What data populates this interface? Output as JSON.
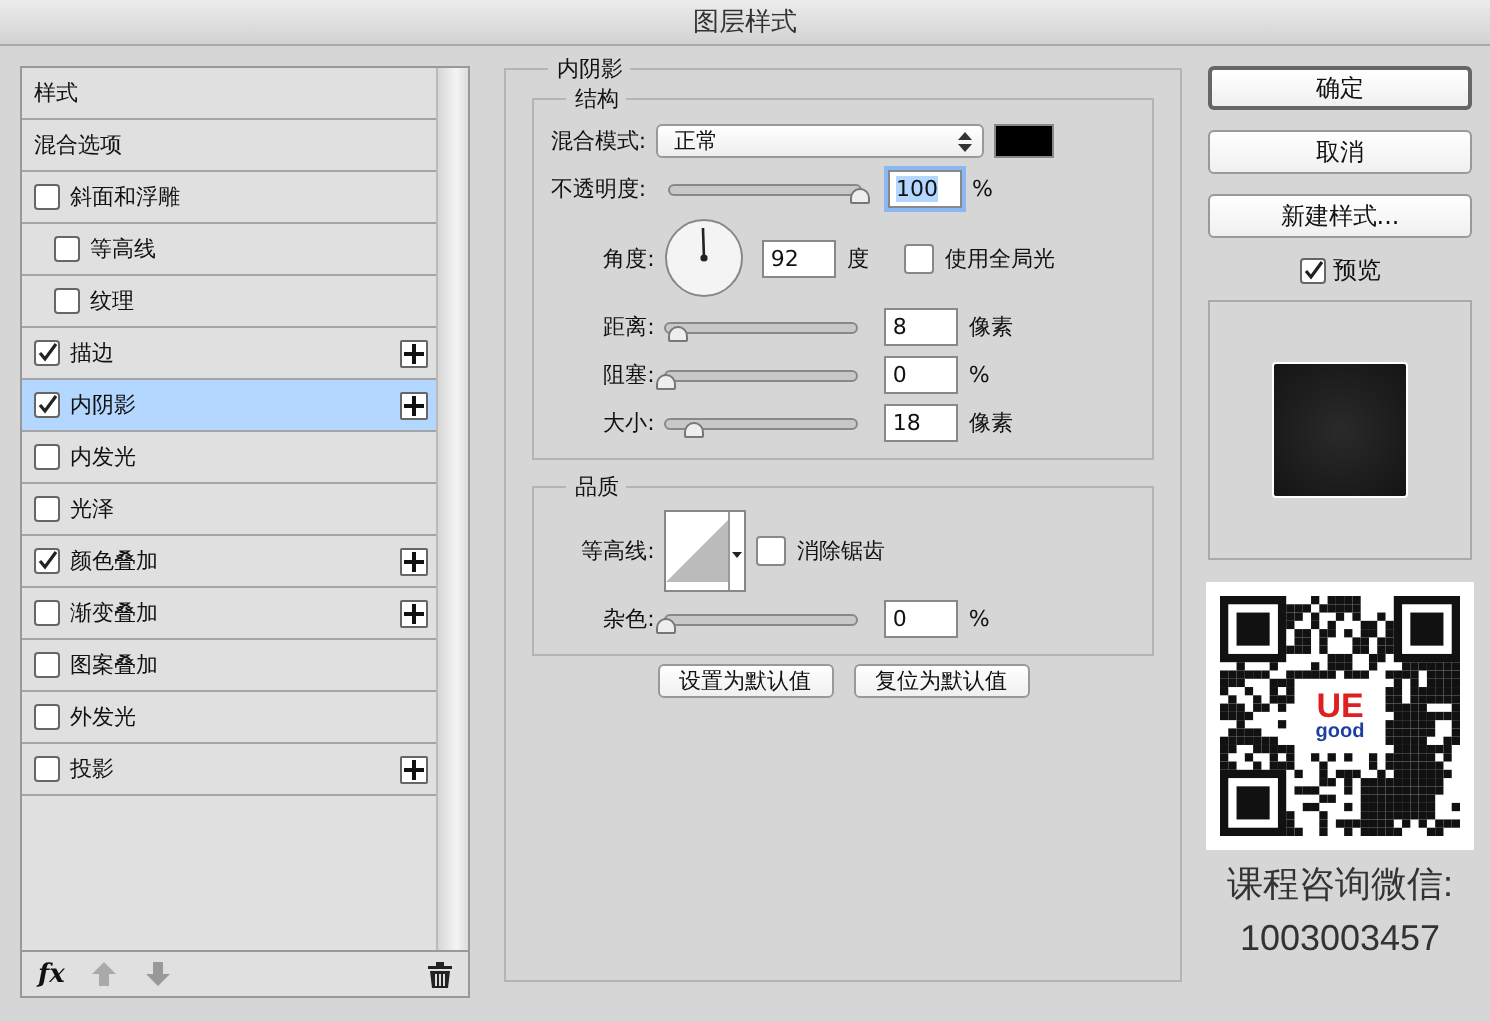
{
  "window": {
    "title": "图层样式"
  },
  "styles": {
    "items": [
      {
        "label": "样式",
        "kind": "header",
        "selected": false
      },
      {
        "label": "混合选项",
        "kind": "header",
        "selected": false
      },
      {
        "label": "斜面和浮雕",
        "kind": "check",
        "checked": false,
        "selected": false,
        "addable": false,
        "children": [
          {
            "label": "等高线",
            "kind": "check",
            "checked": false,
            "selected": false,
            "addable": false
          },
          {
            "label": "纹理",
            "kind": "check",
            "checked": false,
            "selected": false,
            "addable": false
          }
        ]
      },
      {
        "label": "描边",
        "kind": "check",
        "checked": true,
        "selected": false,
        "addable": true
      },
      {
        "label": "内阴影",
        "kind": "check",
        "checked": true,
        "selected": true,
        "addable": true
      },
      {
        "label": "内发光",
        "kind": "check",
        "checked": false,
        "selected": false,
        "addable": false
      },
      {
        "label": "光泽",
        "kind": "check",
        "checked": false,
        "selected": false,
        "addable": false
      },
      {
        "label": "颜色叠加",
        "kind": "check",
        "checked": true,
        "selected": false,
        "addable": true
      },
      {
        "label": "渐变叠加",
        "kind": "check",
        "checked": false,
        "selected": false,
        "addable": true
      },
      {
        "label": "图案叠加",
        "kind": "check",
        "checked": false,
        "selected": false,
        "addable": false
      },
      {
        "label": "外发光",
        "kind": "check",
        "checked": false,
        "selected": false,
        "addable": false
      },
      {
        "label": "投影",
        "kind": "check",
        "checked": false,
        "selected": false,
        "addable": true
      }
    ],
    "fx_label": "fx"
  },
  "effect": {
    "title": "内阴影",
    "structure": {
      "title": "结构",
      "blend_mode": {
        "label": "混合模式:",
        "value": "正常",
        "color": "#000000"
      },
      "opacity": {
        "label": "不透明度:",
        "value": "100",
        "unit": "%",
        "level": 1
      },
      "angle": {
        "label": "角度:",
        "value": "92",
        "unit": "度"
      },
      "global_light": {
        "label": "使用全局光",
        "checked": false
      },
      "sliders": [
        {
          "label": "距离:",
          "value": "8",
          "unit": "像素",
          "level": 0.06
        },
        {
          "label": "阻塞:",
          "value": "0",
          "unit": "%",
          "level": 0
        },
        {
          "label": "大小:",
          "value": "18",
          "unit": "像素",
          "level": 0.14
        }
      ]
    },
    "quality": {
      "title": "品质",
      "contour": {
        "label": "等高线:"
      },
      "anti_alias": {
        "label": "消除锯齿",
        "checked": false
      },
      "noise": {
        "label": "杂色:",
        "value": "0",
        "unit": "%",
        "level": 0
      }
    },
    "buttons": [
      "设置为默认值",
      "复位为默认值"
    ]
  },
  "actions": {
    "buttons": [
      "确定",
      "取消",
      "新建样式..."
    ],
    "preview": {
      "label": "预览",
      "checked": true
    }
  },
  "promo": {
    "qr_logo": [
      "UE",
      "good"
    ],
    "caption": "课程咨询微信:",
    "number": "1003003457"
  }
}
